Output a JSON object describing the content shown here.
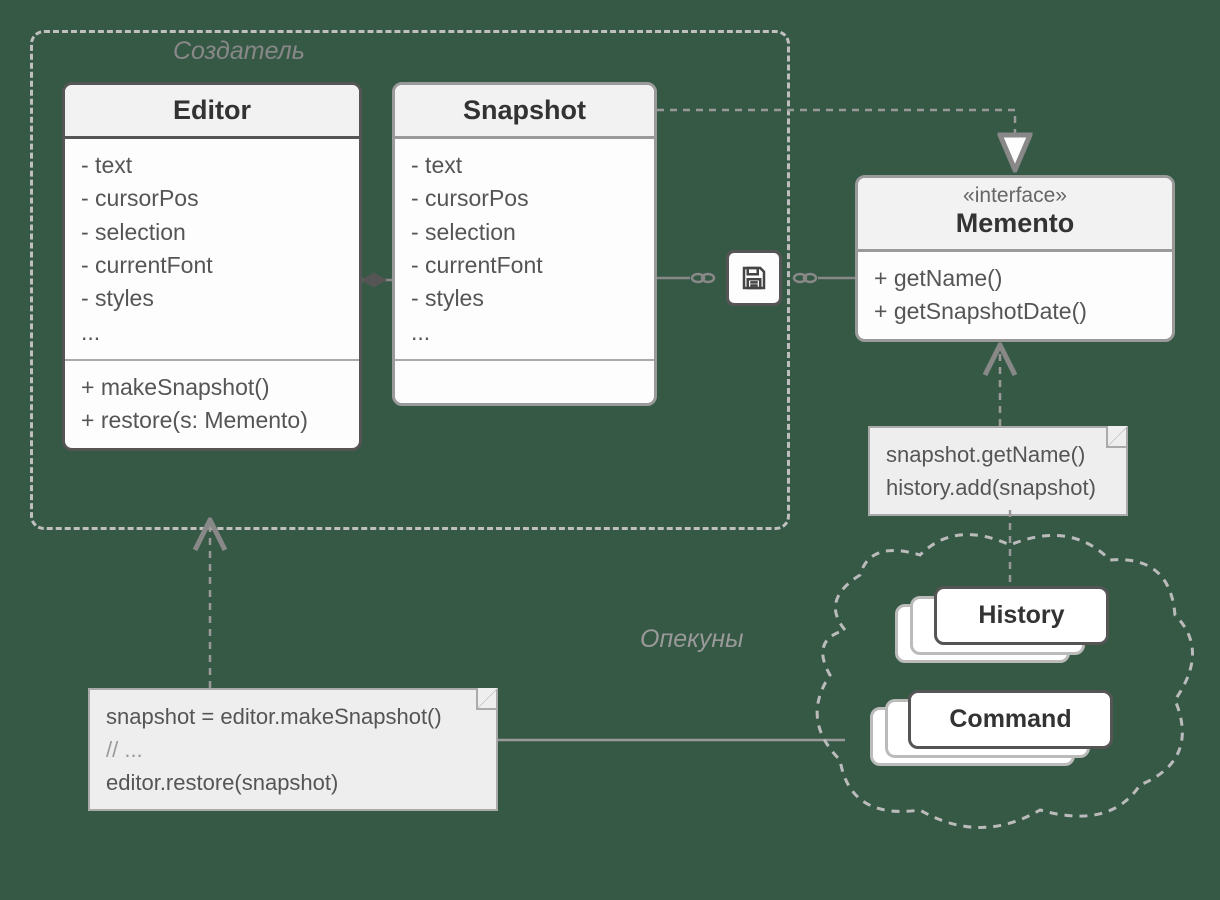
{
  "originator": {
    "label": "Создатель"
  },
  "editor": {
    "title": "Editor",
    "attrs": [
      "- text",
      "- cursorPos",
      "- selection",
      "- currentFont",
      "- styles",
      "..."
    ],
    "ops": [
      "+ makeSnapshot()",
      "+ restore(s: Memento)"
    ]
  },
  "snapshot": {
    "title": "Snapshot",
    "attrs": [
      "- text",
      "- cursorPos",
      "- selection",
      "- currentFont",
      "- styles",
      "..."
    ]
  },
  "memento": {
    "stereotype": "«interface»",
    "title": "Memento",
    "ops": [
      "+ getName()",
      "+ getSnapshotDate()"
    ]
  },
  "note_big": {
    "l1": "snapshot = editor.makeSnapshot()",
    "l2": "// ...",
    "l3": "editor.restore(snapshot)"
  },
  "note_small": {
    "l1": "snapshot.getName()",
    "l2": "history.add(snapshot)"
  },
  "caretakers": {
    "label": "Опекуны",
    "history": "History",
    "command": "Command"
  }
}
